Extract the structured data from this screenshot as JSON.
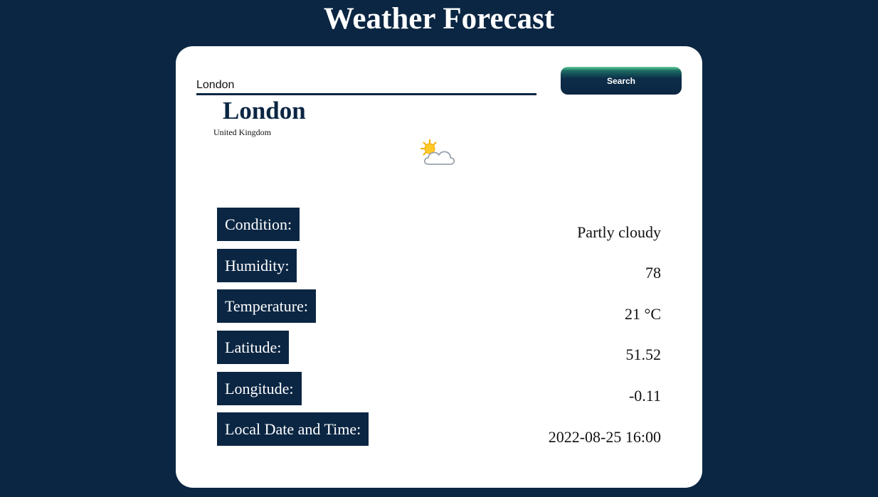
{
  "page": {
    "title": "Weather Forecast"
  },
  "search": {
    "value": "London",
    "button_label": "Search"
  },
  "location": {
    "city": "London",
    "country": "United Kingdom"
  },
  "weather_icon": "partly-cloudy-icon",
  "details": {
    "condition_label": "Condition:",
    "condition_value": "Partly cloudy",
    "humidity_label": "Humidity:",
    "humidity_value": "78",
    "temperature_label": "Temperature:",
    "temperature_value": "21 °C",
    "latitude_label": "Latitude:",
    "latitude_value": "51.52",
    "longitude_label": "Longitude:",
    "longitude_value": "-0.11",
    "datetime_label": "Local Date and Time:",
    "datetime_value": "2022-08-25 16:00"
  },
  "colors": {
    "background": "#0b2643",
    "card": "#ffffff",
    "label_background": "#0b2643",
    "button_accent": "#5fcf9c"
  }
}
